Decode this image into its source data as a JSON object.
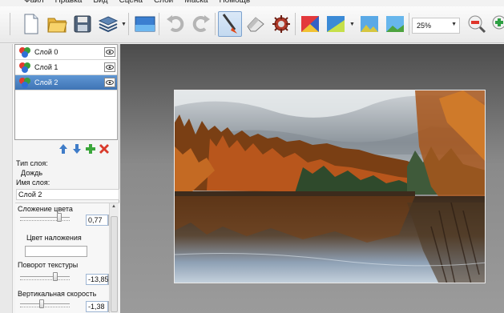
{
  "menu": [
    "Файл",
    "Правка",
    "Вид",
    "Сцена",
    "Слои",
    "Маска",
    "Помощь"
  ],
  "toolbar": {
    "tools": [
      "new-document",
      "open-folder",
      "save",
      "layers",
      "image",
      "undo",
      "redo",
      "brush",
      "eraser",
      "settings",
      "color-fill",
      "gradient",
      "landscape",
      "landscape-2"
    ],
    "zoom_value": "25%"
  },
  "layers": {
    "items": [
      {
        "label": "Слой 0"
      },
      {
        "label": "Слой 1"
      },
      {
        "label": "Слой 2"
      }
    ],
    "selected_index": 2
  },
  "layer_props": {
    "type_label": "Тип слоя:",
    "type_value": "Дождь",
    "name_label": "Имя слоя:",
    "name_value": "Слой 2",
    "color_blend_label": "Сложение цвета",
    "color_blend_value": "0,77",
    "overlay_color_label": "Цвет наложения",
    "texture_rotation_label": "Поворот текстуры",
    "texture_rotation_value": "-13,85",
    "vertical_speed_label": "Вертикальная скорость",
    "vertical_speed_value": "-1,38"
  },
  "colors": {
    "selection": "#3f74b5",
    "canvas_bg": "#8a8a8a"
  }
}
